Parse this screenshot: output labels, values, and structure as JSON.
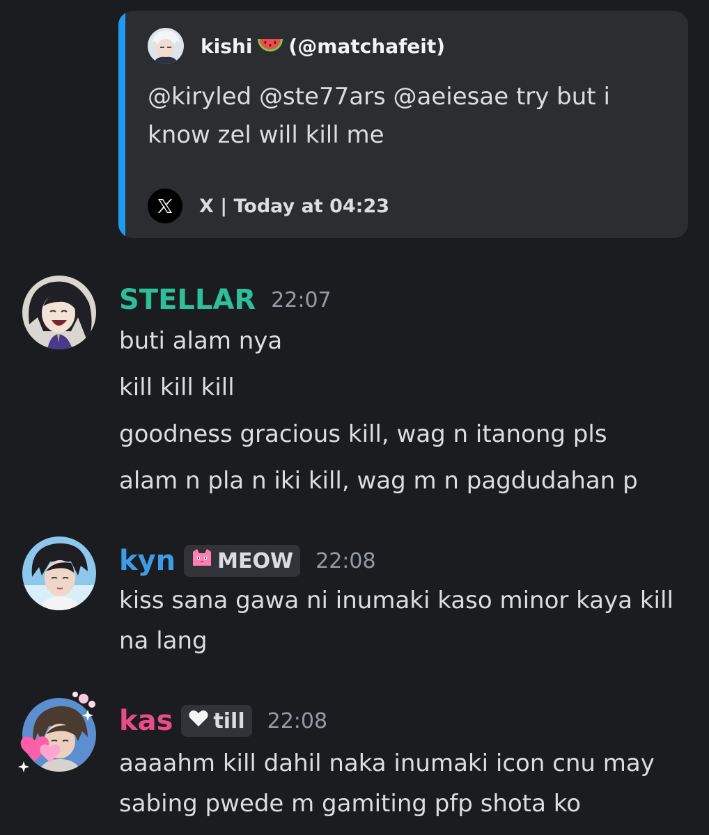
{
  "embed": {
    "author_name": "kishi",
    "author_handle": "(@matchafeit)",
    "description": "@kiryled @ste77ars @aeiesae try but i know zel will kill me",
    "footer": "X | Today at 04:23",
    "accent_color": "#1d9bf0",
    "author_icon": "watermelon-emoji",
    "footer_icon": "x-logo-icon"
  },
  "messages": [
    {
      "username": "STELLAR",
      "username_color": "#2dbf9a",
      "timestamp": "22:07",
      "lines": [
        "buti alam nya",
        "kill kill kill",
        "goodness gracious kill, wag n itanong pls",
        "alam n pla n iki kill, wag m n pagdudahan p"
      ]
    },
    {
      "username": "kyn",
      "username_color": "#3e9ce6",
      "tag": {
        "label": "MEOW",
        "icon": "pink-cat-icon"
      },
      "timestamp": "22:08",
      "lines": [
        "kiss sana gawa ni inumaki kaso minor kaya kill na lang"
      ]
    },
    {
      "username": "kas",
      "username_color": "#e84d8a",
      "tag": {
        "label": "till",
        "icon": "white-heart-icon"
      },
      "timestamp": "22:08",
      "lines": [
        "aaaahm kill dahil naka inumaki icon cnu may sabing pwede m gamiting pfp shota ko"
      ]
    }
  ]
}
